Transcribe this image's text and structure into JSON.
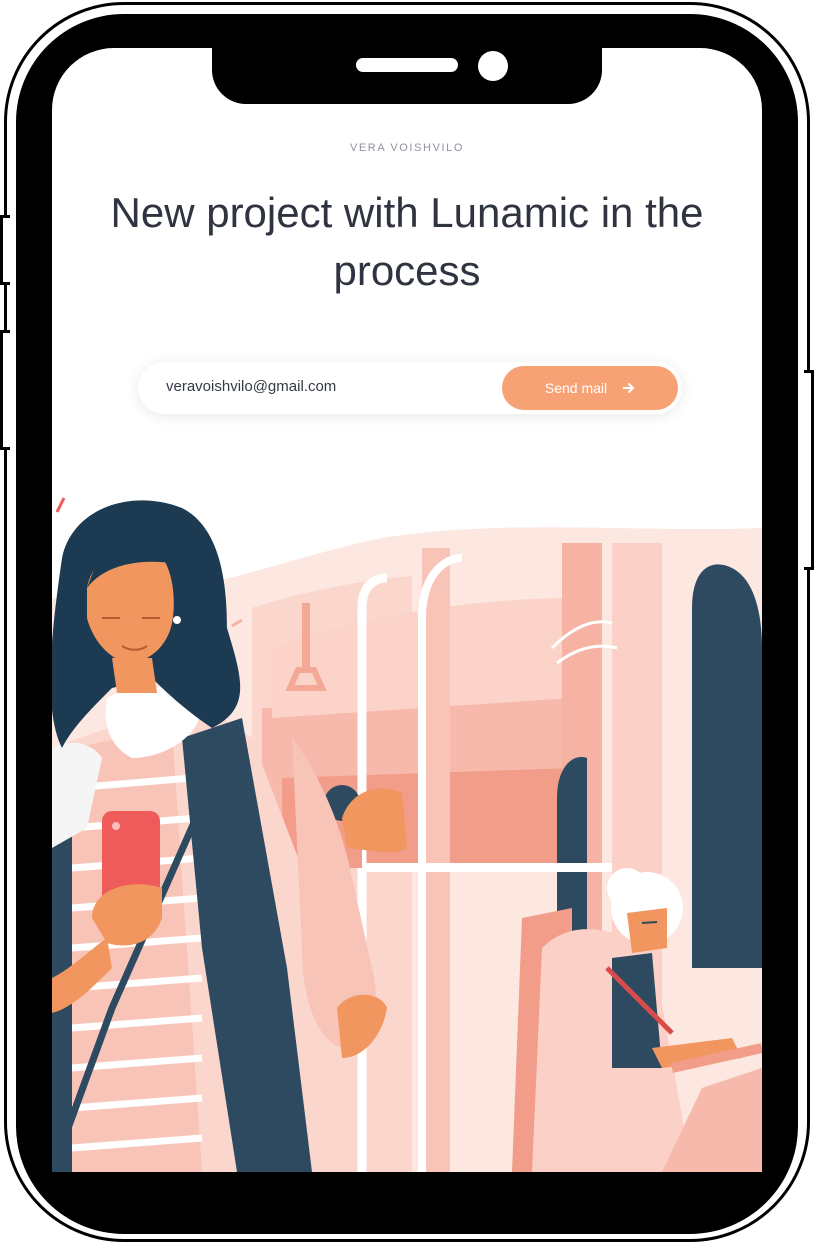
{
  "header": {
    "author": "VERA VOISHVILO"
  },
  "hero": {
    "title": "New project with Lunamic in the process"
  },
  "form": {
    "email_value": "veravoishvilo@gmail.com",
    "send_label": "Send mail",
    "send_icon": "arrow-right-icon"
  },
  "illustration": {
    "subject": "bus-interior-passengers",
    "colors": {
      "pink": "#f7c2b6",
      "salmon": "#f3a08e",
      "navy": "#2d4a60",
      "orange": "#f1965e",
      "red": "#ef5b5b"
    }
  },
  "colors": {
    "accent": "#f6a275",
    "title_text": "#2f3440",
    "muted_text": "#8e939e"
  }
}
